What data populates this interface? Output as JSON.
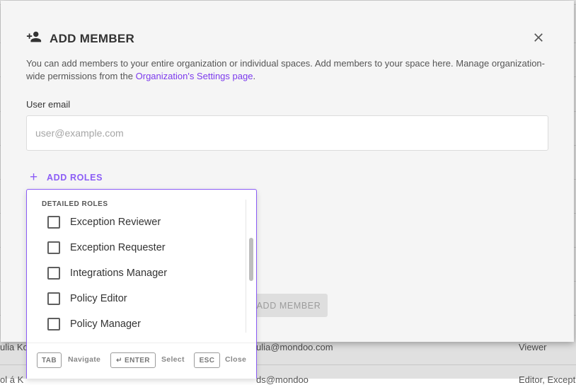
{
  "background": {
    "row_1": {
      "name": "ulia Kor",
      "email": "ulia@mondoo.com",
      "role": "Viewer"
    },
    "row_2": {
      "name": "ol á K",
      "email": "ds@mondoo",
      "role": "Editor, Exceptio"
    }
  },
  "dialog": {
    "title": "ADD MEMBER",
    "title_icon": "person-add-icon",
    "close_icon": "close-icon",
    "description": "You can add members to your entire organization or individual spaces. Add members to your space here. Manage organization-wide permissions from the ",
    "settings_link": "Organization's Settings page",
    "description_end": ".",
    "email_label": "User email",
    "email_placeholder": "user@example.com",
    "email_value": "",
    "add_roles_icon": "plus-icon",
    "add_roles_label": "ADD ROLES",
    "add_member_button": "ADD MEMBER"
  },
  "roles_menu": {
    "section_title": "DETAILED ROLES",
    "items": [
      {
        "label": "Exception Reviewer",
        "checked": false
      },
      {
        "label": "Exception Requester",
        "checked": false
      },
      {
        "label": "Integrations Manager",
        "checked": false
      },
      {
        "label": "Policy Editor",
        "checked": false
      },
      {
        "label": "Policy Manager",
        "checked": false
      }
    ],
    "footer": [
      {
        "key": "TAB",
        "action": "Navigate"
      },
      {
        "key": "↵ ENTER",
        "action": "Select"
      },
      {
        "key": "ESC",
        "action": "Close"
      }
    ]
  },
  "colors": {
    "accent": "#8b5cf6",
    "link": "#7c3aed",
    "dialog_bg": "#f5f5f5",
    "disabled_button_bg": "#dedede"
  }
}
